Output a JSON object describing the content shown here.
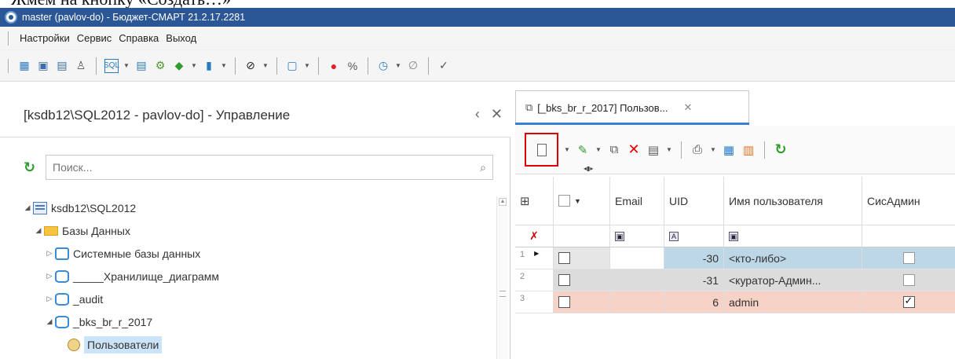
{
  "doc_caption": "Жмем на кнопку «Создать…»",
  "window": {
    "title": "master (pavlov-do) - Бюджет-СМАРТ 21.2.17.2281"
  },
  "menu": [
    "Настройки",
    "Сервис",
    "Справка",
    "Выход"
  ],
  "toolbar_icons": [
    "calendar-icon",
    "monitor-icon",
    "document-list-icon",
    "users-icon",
    "sql-icon",
    "sp-icon",
    "flow-icon",
    "plugin-icon",
    "export-icon",
    "compass-icon",
    "window-icon",
    "record-icon",
    "percent-icon",
    "clock-icon",
    "link-icon",
    "check-circle-icon"
  ],
  "left_panel": {
    "title": "[ksdb12\\SQL2012 - pavlov-do] - Управление",
    "search_placeholder": "Поиск...",
    "tree": [
      {
        "label": "ksdb12\\SQL2012",
        "icon": "server-icon",
        "expanded": true,
        "indent": 0
      },
      {
        "label": "Базы Данных",
        "icon": "folder-icon",
        "expanded": true,
        "indent": 1
      },
      {
        "label": "Системные базы данных",
        "icon": "system-db-icon",
        "expanded": false,
        "indent": 2
      },
      {
        "label": "_____Хранилище_диаграмм",
        "icon": "database-icon",
        "expanded": false,
        "indent": 2
      },
      {
        "label": "_audit",
        "icon": "database-icon",
        "expanded": false,
        "indent": 2
      },
      {
        "label": "_bks_br_r_2017",
        "icon": "database-icon",
        "expanded": true,
        "indent": 2
      },
      {
        "label": "Пользователи",
        "icon": "users-icon",
        "expanded": null,
        "indent": 3,
        "selected": true
      }
    ]
  },
  "right_panel": {
    "tab_label": "[_bks_br_r_2017] Пользов...",
    "grid": {
      "columns": [
        "Email",
        "UID",
        "Имя пользователя",
        "СисАдмин"
      ],
      "rows": [
        {
          "num": "1",
          "email": "",
          "uid": "-30",
          "name": "<кто-либо>",
          "sysadmin": false,
          "color": "#bdd7e6"
        },
        {
          "num": "2",
          "email": "",
          "uid": "-31",
          "name": "<куратор-Админ...",
          "sysadmin": false,
          "color": "#dcdcdc"
        },
        {
          "num": "3",
          "email": "",
          "uid": "6",
          "name": "admin",
          "sysadmin": true,
          "color": "#f6d3c6"
        }
      ]
    }
  }
}
